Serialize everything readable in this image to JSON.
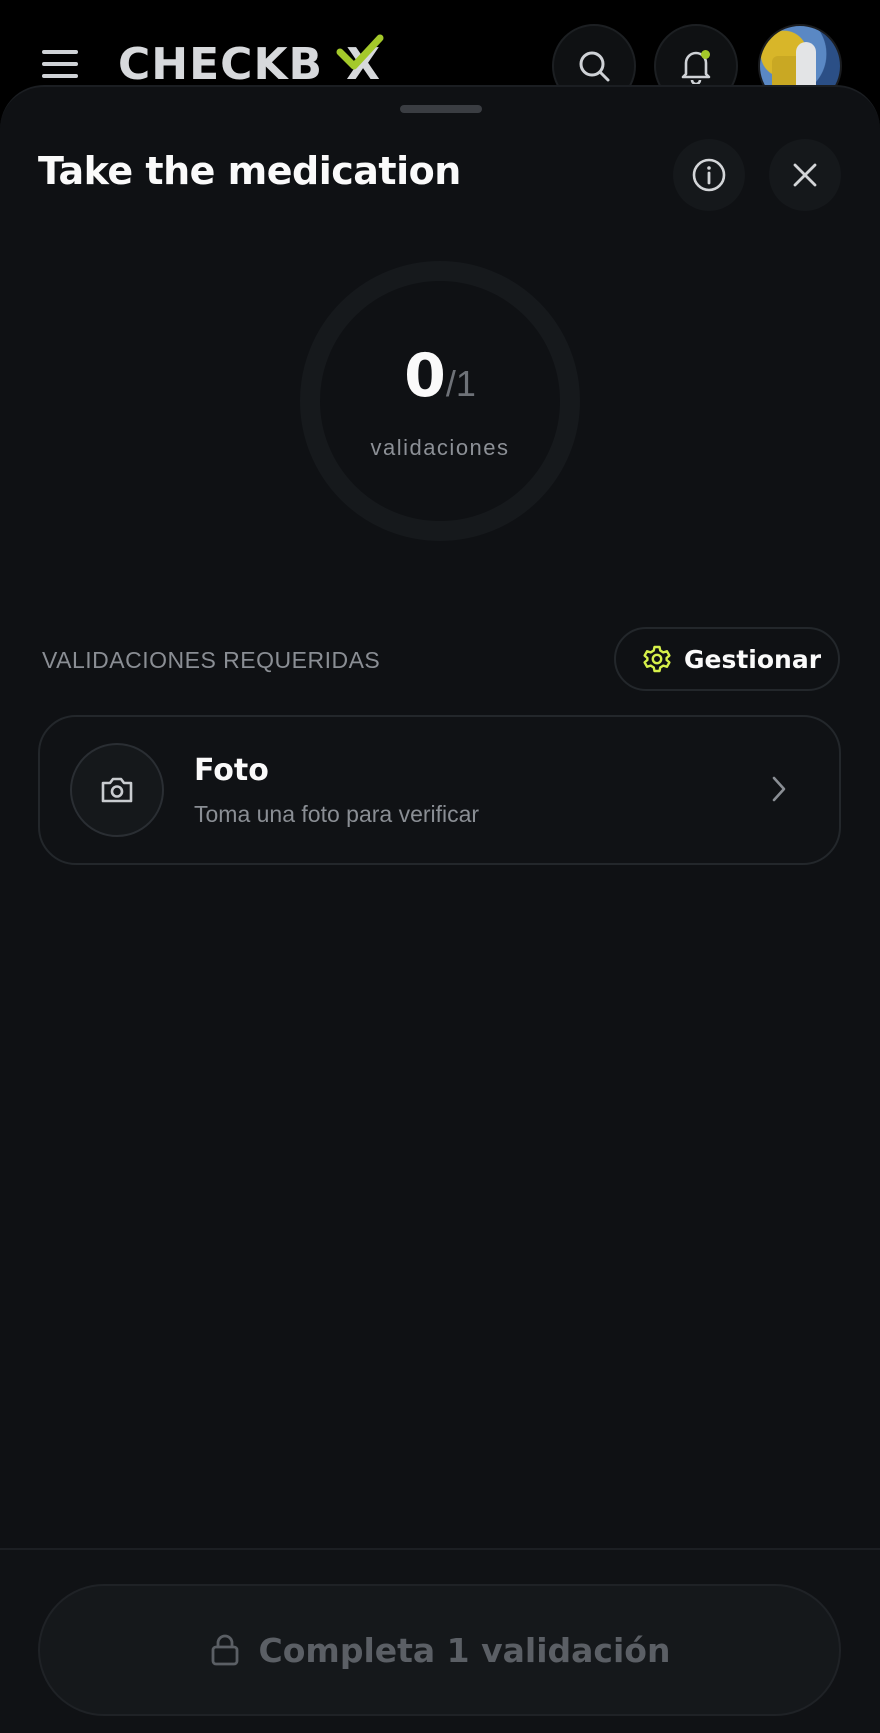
{
  "appbar": {
    "logo": "CHECKB X",
    "icons": {
      "menu": "hamburger-icon",
      "search": "search-icon",
      "notifications": "bell-icon",
      "avatar": "user-avatar"
    },
    "notification_dot_color": "#a4c92a"
  },
  "sheet": {
    "title": "Take the medication",
    "info_icon": "info-icon",
    "close_icon": "close-icon",
    "progress": {
      "done": "0",
      "total": "/1",
      "label": "validaciones",
      "fraction": 0
    },
    "section_label": "VALIDACIONES REQUERIDAS",
    "manage_button": {
      "label": "Gestionar",
      "icon": "gear-icon",
      "icon_color": "#d6f04a"
    },
    "validations": [
      {
        "name": "Foto",
        "description": "Toma una foto para verificar",
        "icon": "camera-icon"
      }
    ],
    "footer_button": {
      "label": "Completa 1 validación",
      "icon": "lock-icon"
    }
  }
}
